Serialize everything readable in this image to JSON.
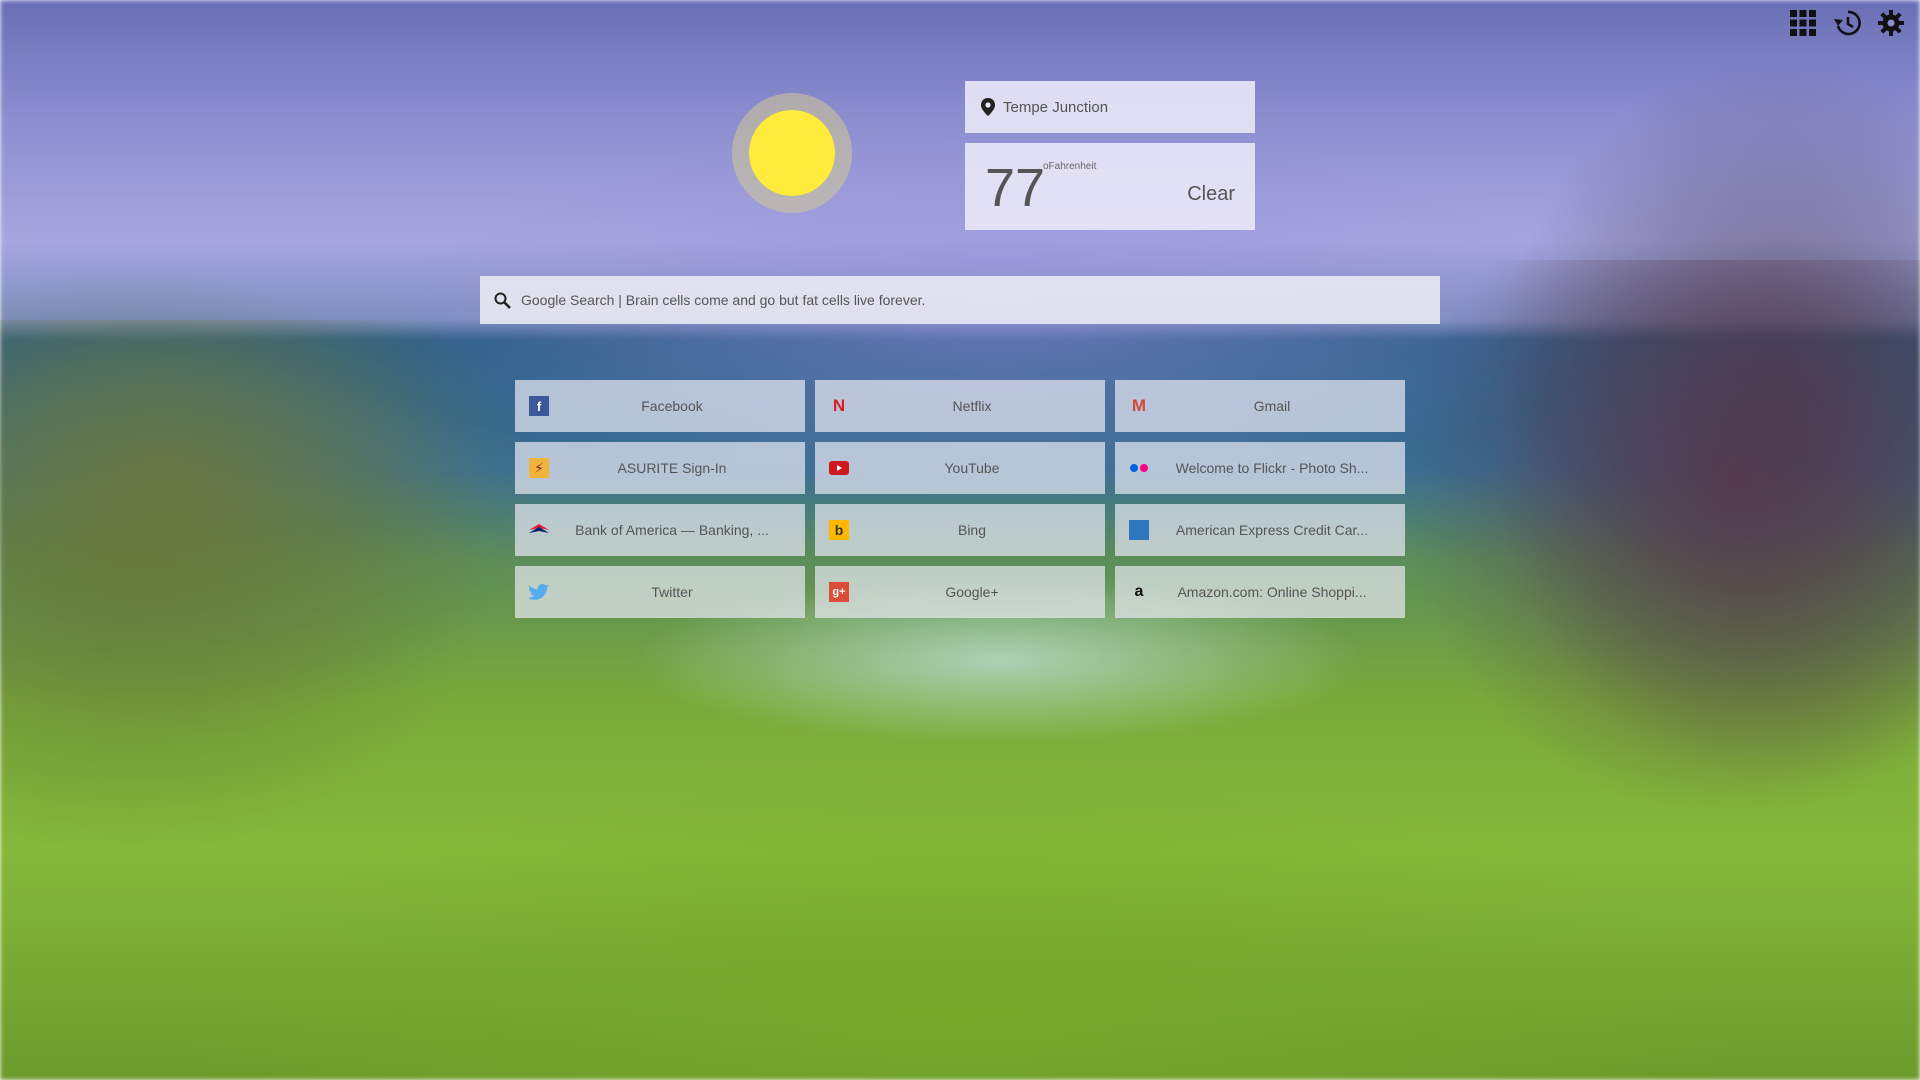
{
  "toolbar": {
    "icons": [
      "apps-grid-icon",
      "history-icon",
      "settings-gear-icon"
    ]
  },
  "weather": {
    "location": "Tempe Junction",
    "temperature": "77",
    "unit": "oFahrenheit",
    "condition": "Clear",
    "icon": "sun-icon",
    "sun_color": "#ffeb3b"
  },
  "search": {
    "text": "Google Search | Brain cells come and go but fat cells live forever."
  },
  "tiles": [
    {
      "label": "Facebook",
      "icon": "facebook-icon"
    },
    {
      "label": "Netflix",
      "icon": "netflix-icon"
    },
    {
      "label": "Gmail",
      "icon": "gmail-icon"
    },
    {
      "label": "ASURITE Sign-In",
      "icon": "asurite-icon"
    },
    {
      "label": "YouTube",
      "icon": "youtube-icon"
    },
    {
      "label": "Welcome to Flickr - Photo Sh...",
      "icon": "flickr-icon"
    },
    {
      "label": "Bank of America — Banking, ...",
      "icon": "bank-of-america-icon"
    },
    {
      "label": "Bing",
      "icon": "bing-icon"
    },
    {
      "label": "American Express Credit Car...",
      "icon": "american-express-icon"
    },
    {
      "label": "Twitter",
      "icon": "twitter-icon"
    },
    {
      "label": "Google+",
      "icon": "google-plus-icon"
    },
    {
      "label": "Amazon.com: Online Shoppi...",
      "icon": "amazon-icon"
    }
  ]
}
